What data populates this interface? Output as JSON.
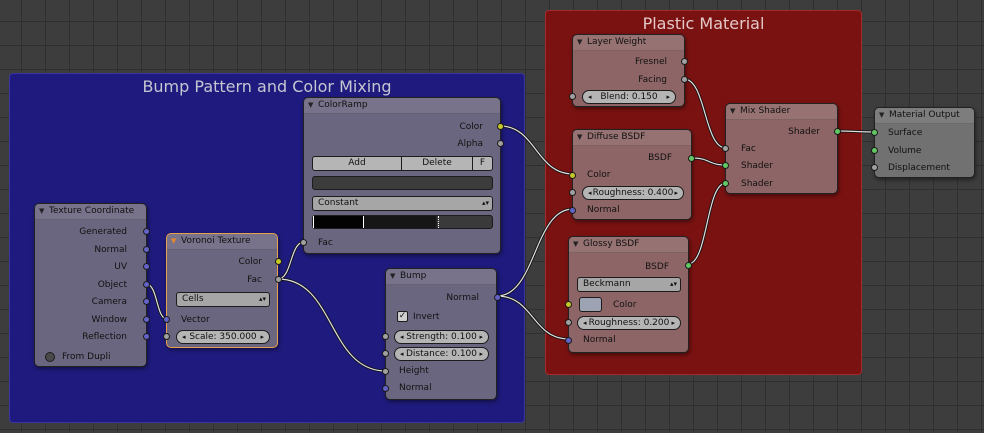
{
  "frames": {
    "bump_title": "Bump Pattern and Color Mixing",
    "plastic_title": "Plastic Material"
  },
  "texture_coordinate": {
    "title": "Texture Coordinate",
    "outputs": [
      "Generated",
      "Normal",
      "UV",
      "Object",
      "Camera",
      "Window",
      "Reflection"
    ],
    "from_dupli": "From Dupli"
  },
  "voronoi": {
    "title": "Voronoi Texture",
    "out_color": "Color",
    "out_fac": "Fac",
    "coloring": "Cells",
    "in_vector": "Vector",
    "scale": "Scale: 350.000"
  },
  "colorramp": {
    "title": "ColorRamp",
    "out_color": "Color",
    "out_alpha": "Alpha",
    "add": "Add",
    "delete": "Delete",
    "flip": "F",
    "interpolation": "Constant",
    "in_fac": "Fac"
  },
  "bump": {
    "title": "Bump",
    "out_normal": "Normal",
    "invert": "Invert",
    "strength": "Strength: 0.100",
    "distance": "Distance: 0.100",
    "in_height": "Height",
    "in_normal": "Normal"
  },
  "layer_weight": {
    "title": "Layer Weight",
    "out_fresnel": "Fresnel",
    "out_facing": "Facing",
    "blend": "Blend: 0.150"
  },
  "diffuse": {
    "title": "Diffuse BSDF",
    "out_bsdf": "BSDF",
    "in_color": "Color",
    "roughness": "Roughness: 0.400",
    "in_normal": "Normal"
  },
  "glossy": {
    "title": "Glossy BSDF",
    "out_bsdf": "BSDF",
    "distribution": "Beckmann",
    "in_color": "Color",
    "roughness": "Roughness: 0.200",
    "in_normal": "Normal"
  },
  "mix_shader": {
    "title": "Mix Shader",
    "out_shader": "Shader",
    "in_fac": "Fac",
    "in_shader1": "Shader",
    "in_shader2": "Shader"
  },
  "material_output": {
    "title": "Material Output",
    "in_surface": "Surface",
    "in_volume": "Volume",
    "in_displacement": "Displacement"
  },
  "colors": {
    "vector_socket": "#6363c7",
    "color_socket": "#c7c729",
    "value_socket": "#a1a1a1",
    "shader_socket": "#63c763",
    "glossy_color": "#9ea3b4"
  }
}
